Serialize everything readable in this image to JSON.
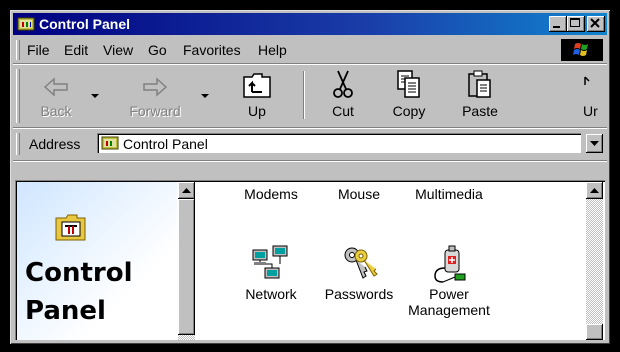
{
  "window": {
    "title": "Control Panel"
  },
  "menu": {
    "items": [
      {
        "label": "File"
      },
      {
        "label": "Edit"
      },
      {
        "label": "View"
      },
      {
        "label": "Go"
      },
      {
        "label": "Favorites"
      },
      {
        "label": "Help"
      }
    ]
  },
  "toolbar": {
    "back": "Back",
    "forward": "Forward",
    "up": "Up",
    "cut": "Cut",
    "copy": "Copy",
    "paste": "Paste",
    "undo_partial": "Ur"
  },
  "address": {
    "label": "Address",
    "value": "Control Panel"
  },
  "left_pane": {
    "title_line1": "Control",
    "title_line2": "Panel"
  },
  "items": {
    "row1": [
      "Modems",
      "Mouse",
      "Multimedia"
    ],
    "network": "Network",
    "passwords": "Passwords",
    "power_line1": "Power",
    "power_line2": "Management"
  },
  "colors": {
    "titlebar": "#000080",
    "face": "#c0c0c0"
  }
}
